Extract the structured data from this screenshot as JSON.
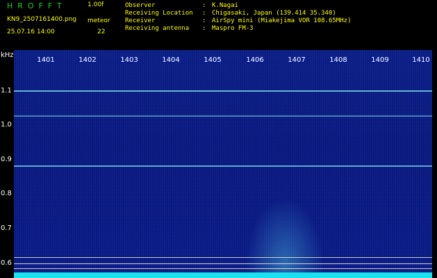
{
  "header": {
    "logo": "HROFFT",
    "version": "1.00f",
    "filename": "KN9_2507161400.png",
    "meteor_label": "meteor",
    "timestamp": "25.07.16 14:00",
    "meteor_count": "22",
    "info": [
      {
        "key": "Observer",
        "value": "K.Nagai"
      },
      {
        "key": "Receiving Location",
        "value": "Chigasaki, Japan (139.414 35.340)"
      },
      {
        "key": "Receiver",
        "value": "AirSpy mini (Miakejima VOR 108.65MHz)"
      },
      {
        "key": "Receiving antenna",
        "value": "Maspro FM-3"
      }
    ],
    "separator": ":"
  },
  "spectrogram": {
    "unit": "kHz",
    "time_labels": [
      "1401",
      "1402",
      "1403",
      "1404",
      "1405",
      "1406",
      "1407",
      "1408",
      "1409",
      "1410"
    ],
    "freq_labels": [
      "1.1",
      "1.0",
      "0.9",
      "0.8",
      "0.7",
      "0.6"
    ],
    "colors": {
      "background": "#0b1f8c",
      "floor": "#19e2ee",
      "text": "#ffff00",
      "logo": "#1fd21f"
    }
  }
}
